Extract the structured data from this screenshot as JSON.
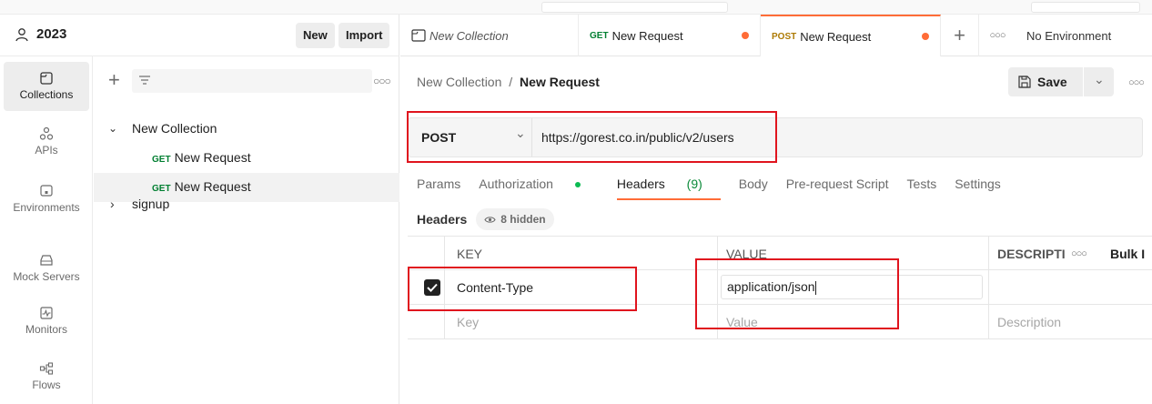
{
  "workspace": {
    "name": "2023",
    "new_label": "New",
    "import_label": "Import"
  },
  "nav": [
    {
      "label": "Collections",
      "icon": "collections-icon"
    },
    {
      "label": "APIs",
      "icon": "apis-icon"
    },
    {
      "label": "Environments",
      "icon": "environments-icon"
    },
    {
      "label": "Mock Servers",
      "icon": "mock-servers-icon"
    },
    {
      "label": "Monitors",
      "icon": "monitors-icon"
    },
    {
      "label": "Flows",
      "icon": "flows-icon"
    }
  ],
  "tree": {
    "collection": "New Collection",
    "items": [
      {
        "method": "GET",
        "label": "New Request"
      },
      {
        "method": "GET",
        "label": "New Request"
      }
    ],
    "folder": "signup"
  },
  "tabs": [
    {
      "label": "New Collection",
      "method": ""
    },
    {
      "label": "New Request",
      "method": "GET"
    },
    {
      "label": "New Request",
      "method": "POST"
    }
  ],
  "environment": "No Environment",
  "breadcrumb": {
    "parent": "New Collection",
    "separator": "/",
    "current": "New Request"
  },
  "save_label": "Save",
  "request": {
    "method": "POST",
    "url": "https://gorest.co.in/public/v2/users"
  },
  "subtabs": {
    "params": "Params",
    "authorization": "Authorization",
    "headers": "Headers",
    "headers_count": "(9)",
    "body": "Body",
    "prerequest": "Pre-request Script",
    "tests": "Tests",
    "settings": "Settings"
  },
  "headers_section": {
    "title": "Headers",
    "hidden": "8 hidden"
  },
  "table": {
    "col_key": "KEY",
    "col_value": "VALUE",
    "col_desc": "DESCRIPTI",
    "bulk": "Bulk I",
    "rows": [
      {
        "key": "Content-Type",
        "value": "application/json",
        "checked": true
      }
    ],
    "placeholder_key": "Key",
    "placeholder_value": "Value",
    "placeholder_desc": "Description"
  },
  "colors": {
    "accent": "#ff6c37",
    "get": "#007f31",
    "post": "#ad7a03",
    "highlight": "#e0141e",
    "auth_dot": "#0cbb52"
  }
}
